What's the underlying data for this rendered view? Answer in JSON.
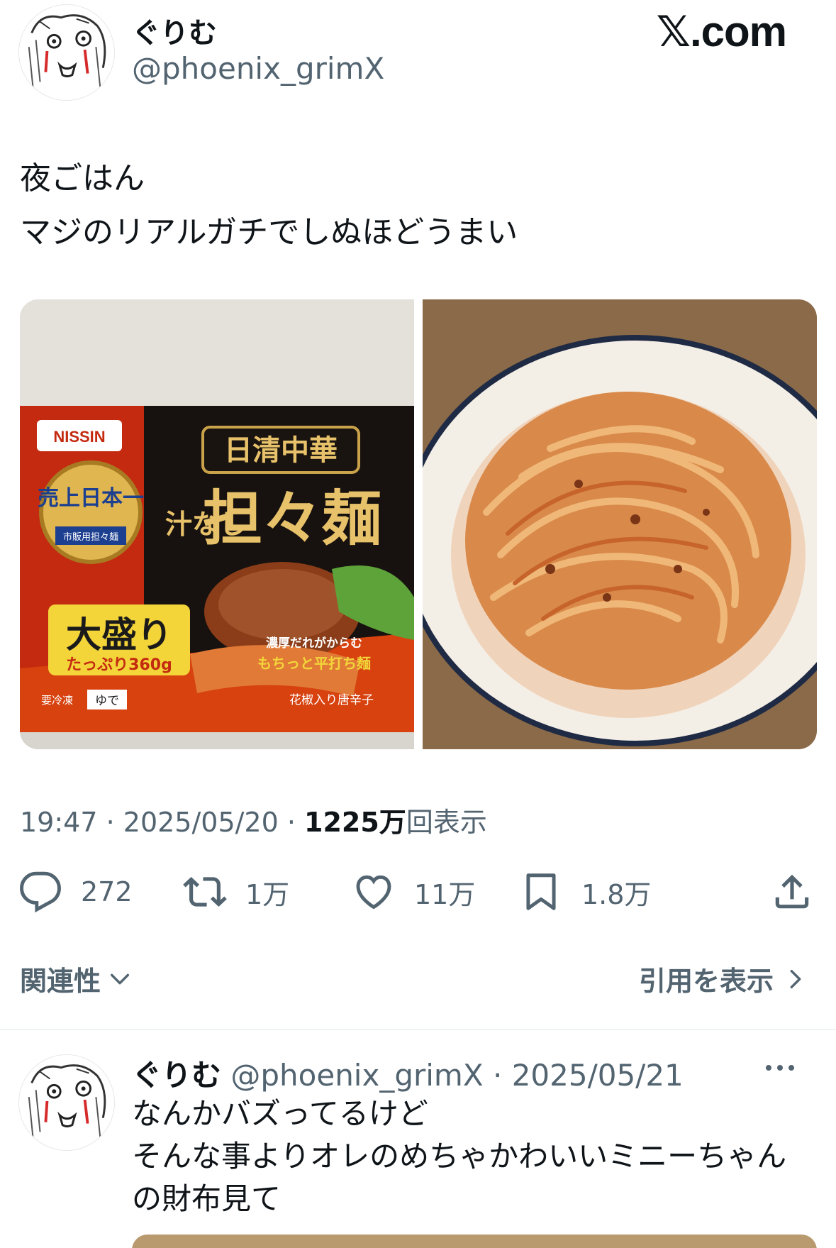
{
  "header": {
    "display_name": "ぐりむ",
    "handle": "@phoenix_grimX",
    "brand": "𝕏.com"
  },
  "tweet": {
    "lines": [
      "夜ごはん",
      "マジのリアルガチでしぬほどうまい"
    ],
    "package_text": {
      "maker": "NISSIN",
      "brand_line": "日清中華",
      "product_a": "汁なし",
      "product_b": "担々麺",
      "badge": "売上日本一",
      "badge_sub": "市販用担々麺",
      "big_serving": "大盛り",
      "amount": "たっぷり360g",
      "tagline": "濃厚だれがからむ",
      "noodle": "もちっと平打ち麺",
      "spice": "花椒入り唐辛子",
      "frozen": "要冷凍",
      "boil": "ゆで"
    },
    "time": "19:47",
    "date": "2025/05/20",
    "views_num": "1225万",
    "views_label": "回表示",
    "sep": " · "
  },
  "actions": {
    "replies": "272",
    "retweets": "1万",
    "likes": "11万",
    "bookmarks": "1.8万"
  },
  "sort": {
    "label": "関連性"
  },
  "quotes": {
    "label": "引用を表示"
  },
  "reply": {
    "display_name": "ぐりむ",
    "handle": "@phoenix_grimX",
    "date": "2025/05/21",
    "sep": " · ",
    "lines": [
      "なんかバズってるけど",
      "そんな事よりオレのめちゃかわいいミニーちゃん",
      "の財布見て"
    ]
  },
  "colors": {
    "text_primary": "#0f1419",
    "text_secondary": "#536471",
    "divider": "#eff3f4"
  },
  "icons": [
    "avatar-sketch-icon",
    "reply-icon",
    "retweet-icon",
    "like-icon",
    "bookmark-icon",
    "share-icon",
    "chevron-down-icon",
    "chevron-right-icon",
    "more-icon"
  ]
}
